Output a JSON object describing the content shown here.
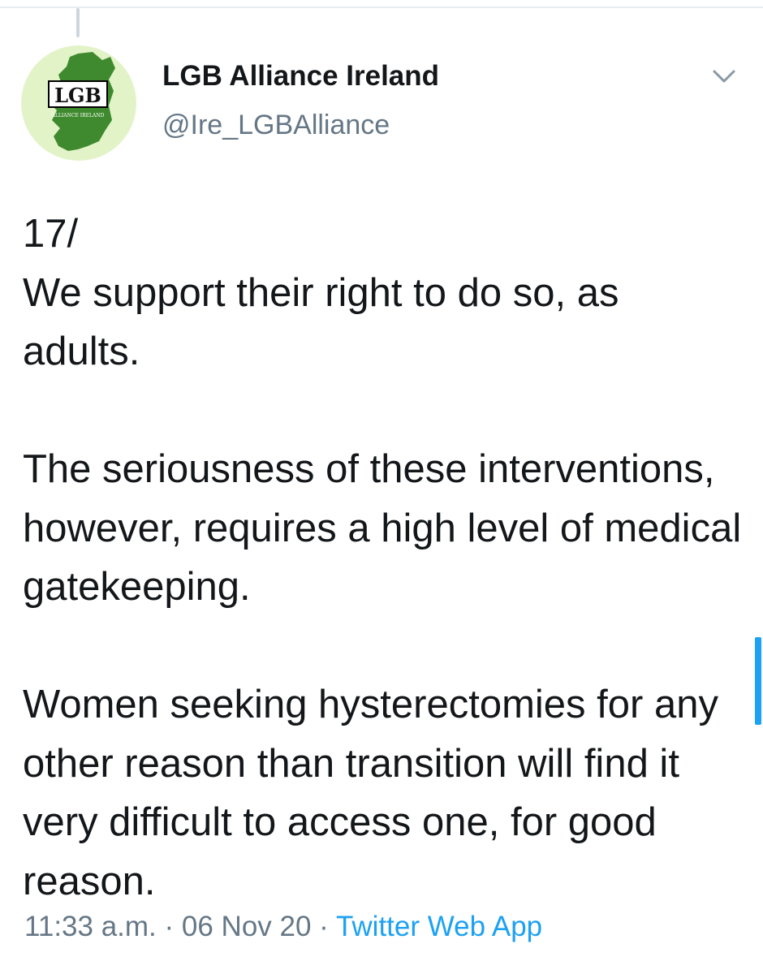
{
  "tweet": {
    "author": {
      "display_name": "LGB Alliance Ireland",
      "handle": "@Ire_LGBAlliance",
      "avatar_logo_text": "LGB",
      "avatar_logo_subtext": "ALLIANCE IRELAND",
      "avatar_colors": {
        "background": "#e3f3c8",
        "map": "#3f8a2e"
      }
    },
    "text": "17/\nWe support their right to do so, as adults.\n\nThe seriousness of these interventions, however, requires a high level of medical gatekeeping.\n\nWomen seeking hysterectomies for any other reason than transition will find it very difficult to access one, for good reason.",
    "time": "11:33 a.m.",
    "date": "06 Nov 20",
    "separator": " · ",
    "source": "Twitter Web App",
    "icons": {
      "menu": "chevron-down-icon"
    }
  },
  "colors": {
    "accent": "#1da1f2",
    "secondary_text": "#657786",
    "primary_text": "#14171a"
  }
}
